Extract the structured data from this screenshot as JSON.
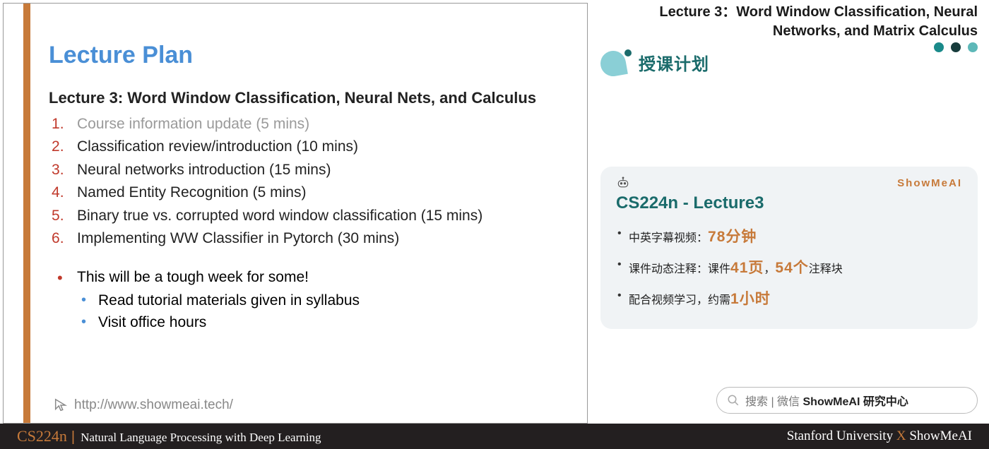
{
  "left": {
    "title": "Lecture Plan",
    "subtitle": "Lecture 3: Word Window Classification, Neural Nets, and Calculus",
    "items": [
      "Course information update (5 mins)",
      "Classification review/introduction (10 mins)",
      "Neural networks introduction (15 mins)",
      "Named Entity Recognition (5 mins)",
      "Binary true vs. corrupted word window classification (15 mins)",
      "Implementing WW Classifier in Pytorch (30 mins)"
    ],
    "note_main": "This will be a tough week for some!",
    "note_sub1": "Read tutorial materials given in syllabus",
    "note_sub2": "Visit office hours",
    "link": "http://www.showmeai.tech/"
  },
  "right": {
    "header_line1": "Lecture 3：Word Window Classification, Neural",
    "header_line2": "Networks, and Matrix Calculus",
    "section_title": "授课计划",
    "card": {
      "brand": "ShowMeAI",
      "title": "CS224n - Lecture3",
      "row1_prefix": "中英字幕视频：",
      "row1_highlight": "78分钟",
      "row2_prefix": "课件动态注释：课件",
      "row2_h1": "41页",
      "row2_mid": "，",
      "row2_h2": "54个",
      "row2_suffix": "注释块",
      "row3_prefix": "配合视频学习，约需",
      "row3_highlight": "1小时"
    },
    "search_prefix": "搜索 | 微信 ",
    "search_bold": "ShowMeAI 研究中心"
  },
  "footer": {
    "code": "CS224n",
    "divider": "|",
    "name": "Natural Language Processing with Deep Learning",
    "right_a": "Stanford University ",
    "right_x": "X",
    "right_b": " ShowMeAI"
  }
}
